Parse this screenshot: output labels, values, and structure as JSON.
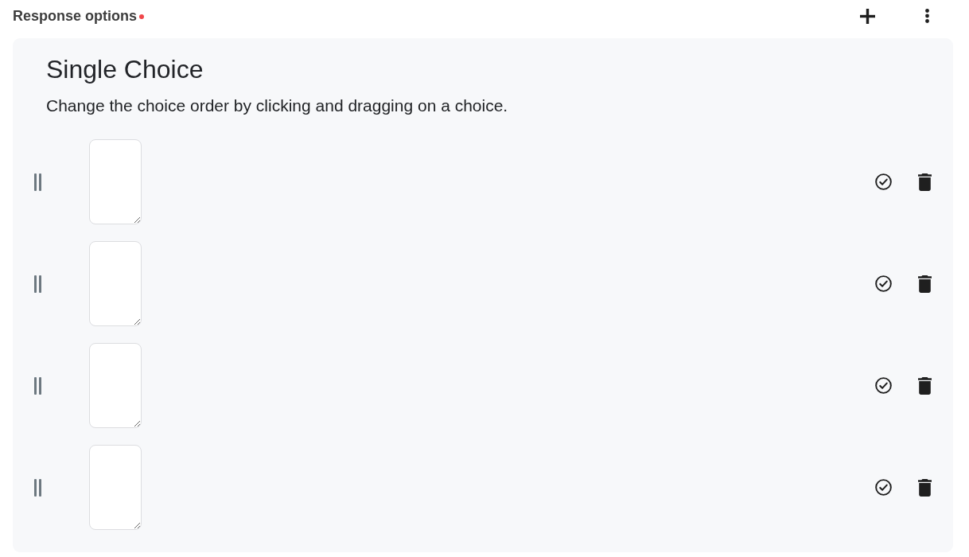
{
  "response_options": {
    "label": "Response options",
    "required": true
  },
  "panel": {
    "title": "Single Choice",
    "hint": "Change the choice order by clicking and dragging on a choice."
  },
  "choices": [
    {
      "correct": false
    },
    {
      "correct": false
    },
    {
      "correct": false
    },
    {
      "correct": false
    }
  ]
}
